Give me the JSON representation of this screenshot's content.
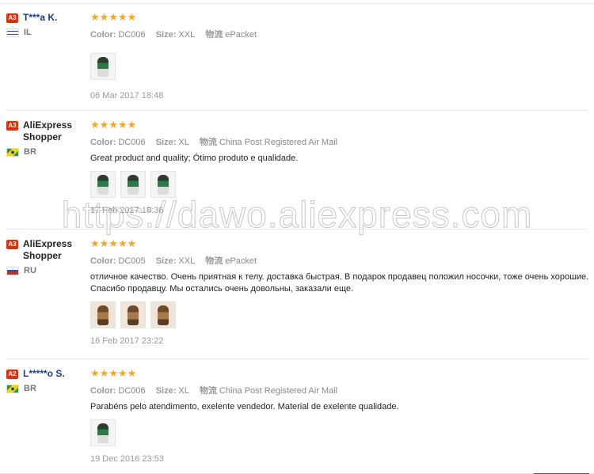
{
  "reviews": [
    {
      "badge": "A3",
      "name": "T***a K.",
      "country_code": "IL",
      "color_label": "Color:",
      "color": "DC006",
      "size_label": "Size:",
      "size": "XXL",
      "shipping_label": "物流",
      "shipping": "ePacket",
      "rating": 5,
      "stars": "★★★★★",
      "text": "",
      "photo_count": 1,
      "date": "06 Mar 2017 18:48"
    },
    {
      "badge": "A3",
      "name": "AliExpress Shopper",
      "country_code": "BR",
      "color_label": "Color:",
      "color": "DC006",
      "size_label": "Size:",
      "size": "XL",
      "shipping_label": "物流",
      "shipping": "China Post Registered Air Mail",
      "rating": 5,
      "stars": "★★★★★",
      "text": "Great product and quality; Ótimo produto e qualidade.",
      "photo_count": 3,
      "date": "17 Feb 2017 18:36"
    },
    {
      "badge": "A3",
      "name": "AliExpress Shopper",
      "country_code": "RU",
      "color_label": "Color:",
      "color": "DC005",
      "size_label": "Size:",
      "size": "XXL",
      "shipping_label": "物流",
      "shipping": "ePacket",
      "rating": 5,
      "stars": "★★★★★",
      "text": "отличное качество. Очень приятная к телу. доставка быстрая. В подарок продавец положил носочки, тоже очень хорошие. Спасибо продавцу. Мы остались очень довольны, заказали еще.",
      "photo_count": 3,
      "date": "16 Feb 2017 23:22"
    },
    {
      "badge": "A2",
      "name": "L*****o S.",
      "country_code": "BR",
      "color_label": "Color:",
      "color": "DC006",
      "size_label": "Size:",
      "size": "XL",
      "shipping_label": "物流",
      "shipping": "China Post Registered Air Mail",
      "rating": 5,
      "stars": "★★★★★",
      "text": "Parabéns pelo atendimento, exelente vendedor. Material de exelente qualidade.",
      "photo_count": 1,
      "date": "19 Dec 2016 23:53"
    }
  ],
  "watermark": "https://dawo.aliexpress.com",
  "colors": {
    "badge": "#e62e04",
    "star": "#f5a623",
    "masked_name": "#1a3b8a"
  }
}
